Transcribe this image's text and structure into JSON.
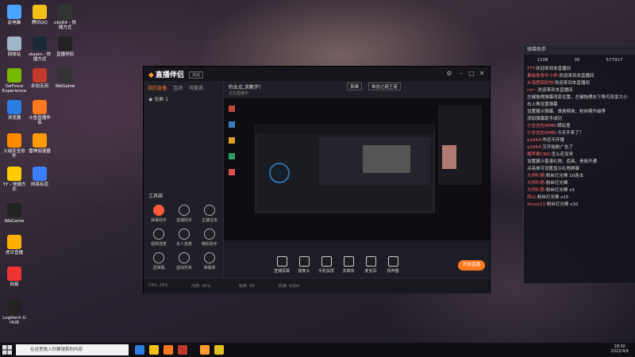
{
  "desktop": {
    "icons": [
      {
        "label": "此电脑",
        "color": "#4aa3ff"
      },
      {
        "label": "腾讯QQ",
        "color": "#f2c018"
      },
      {
        "label": "obs64 - 快捷方式",
        "color": "#333"
      },
      {
        "label": "回收站",
        "color": "#9fb7c8"
      },
      {
        "label": "steam - 快捷方式",
        "color": "#1b2838"
      },
      {
        "label": "直播伴侣",
        "color": "#222"
      },
      {
        "label": "GeForce Experience",
        "color": "#76b900"
      },
      {
        "label": "永劫无间",
        "color": "#c0392b"
      },
      {
        "label": "WeGame",
        "color": "#333"
      },
      {
        "label": "浏览器",
        "color": "#2a7de1"
      },
      {
        "label": "斗鱼直播伴侣",
        "color": "#ff7a1f"
      },
      {
        "label": "火绒安全软件",
        "color": "#ff8c00"
      },
      {
        "label": "雷神加速器",
        "color": "#ff9a00"
      },
      {
        "label": "YY - 快捷方式",
        "color": "#ffcc00"
      },
      {
        "label": "网易有道",
        "color": "#3d7eff"
      },
      {
        "label": "WeGame",
        "color": "#222"
      },
      {
        "label": "虎牙直播",
        "color": "#ffb000"
      },
      {
        "label": "网易",
        "color": "#e33"
      },
      {
        "label": "Logitech G HUB",
        "color": "#222"
      }
    ]
  },
  "window": {
    "app_name": "直播伴侣",
    "badge": "测试",
    "tabs": [
      "我的直播",
      "互动",
      "可能说"
    ],
    "scene_label": "全屏 1",
    "tools_title": "工具箱",
    "tools": [
      {
        "label": "弹幕助手"
      },
      {
        "label": "直播助手"
      },
      {
        "label": "主播任务"
      },
      {
        "label": "视频连麦"
      },
      {
        "label": "多人连麦"
      },
      {
        "label": "精彩助手"
      },
      {
        "label": "送弹幕"
      },
      {
        "label": "虚拟形象"
      },
      {
        "label": "弹幕库"
      }
    ],
    "room_title": "豹女瓜,求教学！",
    "tags": [
      "英雄",
      "峡谷之巅王者"
    ],
    "status_row": "正在直播中",
    "bottom_buttons": [
      {
        "label": "直播屏幕"
      },
      {
        "label": "摄像头"
      },
      {
        "label": "手机投屏"
      },
      {
        "label": "多媒体"
      },
      {
        "label": "麦克风"
      },
      {
        "label": "扬声器"
      }
    ],
    "start_button": "开始直播",
    "status_items": [
      "CPU: 25%",
      "内存: 45%",
      "帧率: 60",
      "码率: 6000"
    ]
  },
  "chat": {
    "title": "弹幕助手",
    "stats": [
      "1108",
      "35",
      "577917"
    ],
    "messages": [
      {
        "name": "TTT:",
        "text": "欢迎来到本直播间"
      },
      {
        "name": "素级卷青年小李:",
        "text": "欢迎来到本直播间"
      },
      {
        "name": "从海里回到地:",
        "text": "欢迎来到本直播间"
      },
      {
        "name": "nd~:",
        "text": "欢迎来到本直播间"
      },
      {
        "name": "",
        "text": "左键拖拽弹幕改变位置，左键拖拽右下角可改变大小"
      },
      {
        "name": "",
        "text": "右上角设置弹幕"
      },
      {
        "name": "",
        "text": "设置展示弹幕、贵族榜单、粉丝榜升级等"
      },
      {
        "name": "",
        "text": "添加弹幕助手成功"
      },
      {
        "name": "小吉吉在WMN:",
        "text": "晒玩意"
      },
      {
        "name": "小吉吉在WMN:",
        "text": "今天不来了？"
      },
      {
        "name": "q1864:",
        "text": "咋还不开播"
      },
      {
        "name": "q1864:",
        "text": "又开始刷广告了"
      },
      {
        "name": "摘苹果CNO:",
        "text": "怎么还没来"
      },
      {
        "name": "",
        "text": "设置展示香港礼物、道具、贵族开通"
      },
      {
        "name": "",
        "text": "点亮单可设置显示礼物屏蔽"
      },
      {
        "name": "大师叭萌:",
        "text": "粉丝灯光棒 10连击"
      },
      {
        "name": "大师叭萌:",
        "text": "粉丝灯光棒"
      },
      {
        "name": "大师叭萌:",
        "text": "粉丝灯光棒 x3"
      },
      {
        "name": "西山:",
        "text": "粉丝灯光棒 x15"
      },
      {
        "name": "zhuzy11:",
        "text": "粉丝灯光棒 x10"
      }
    ]
  },
  "taskbar": {
    "search_placeholder": "在这里输入你要搜索的内容",
    "time": "18:50",
    "date": "2022/4/4"
  },
  "colors": {
    "accent": "#ff7a1f",
    "chat_name": "#ff6a6a"
  }
}
